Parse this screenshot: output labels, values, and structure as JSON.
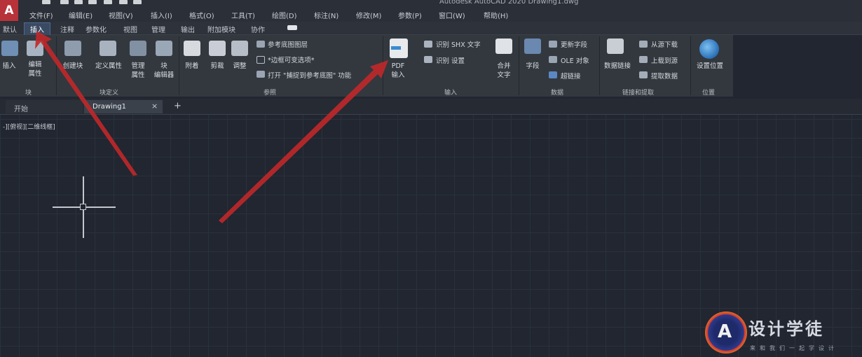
{
  "app": {
    "logo": "A",
    "title": "Autodesk AutoCAD 2020  Drawing1.dwg"
  },
  "menu": [
    "文件(F)",
    "编辑(E)",
    "视图(V)",
    "插入(I)",
    "格式(O)",
    "工具(T)",
    "绘图(D)",
    "标注(N)",
    "修改(M)",
    "参数(P)",
    "窗口(W)",
    "帮助(H)"
  ],
  "ribbon_tabs": [
    "默认",
    "插入",
    "注释",
    "参数化",
    "视图",
    "管理",
    "输出",
    "附加模块",
    "协作"
  ],
  "panels": {
    "block": {
      "title": "块",
      "insert_label": "插入",
      "edit_attr_label": "编辑\n属性",
      "create_label": "创建块"
    },
    "block_def": {
      "title": "块定义",
      "define_attr_label": "定义属性",
      "manage_attr_label": "管理\n属性",
      "block_editor_label": "块\n编辑器"
    },
    "reference": {
      "title": "参照",
      "attach_label": "附着",
      "clip_label": "剪裁",
      "adjust_label": "调整",
      "underlay_layers": "参考底图图层",
      "frames_variable": "*边框可变选项*",
      "snap_to_underlay": "打开 \"捕捉到参考底图\" 功能"
    },
    "import": {
      "title": "输入",
      "pdf_import_label": "PDF\n输入",
      "recognize_shx": "识别 SHX 文字",
      "recognize_settings": "识别 设置",
      "combine_text_label": "合并\n文字"
    },
    "data": {
      "title": "数据",
      "field_label": "字段",
      "update_fields": "更新字段",
      "ole_object": "OLE 对象",
      "hyperlink": "超链接"
    },
    "link_extract": {
      "title": "链接和提取",
      "data_link_label": "数据链接",
      "download_from_source": "从源下载",
      "upload_to_source": "上载到源",
      "extract_data": "提取数据"
    },
    "location": {
      "title": "位置",
      "set_location_label": "设置位置"
    }
  },
  "doc_tabs": {
    "start": "开始",
    "drawing": "Drawing1",
    "close": "×",
    "add": "+"
  },
  "viewport_label": "-][俯视][二维线框]",
  "watermark": {
    "brand": "设计学徒",
    "slogan": "来和我们一起学设计"
  },
  "colors": {
    "accent_active_tab": "#3a4a63",
    "arrow_red": "#c0282a",
    "canvas_bg": "#212630"
  }
}
